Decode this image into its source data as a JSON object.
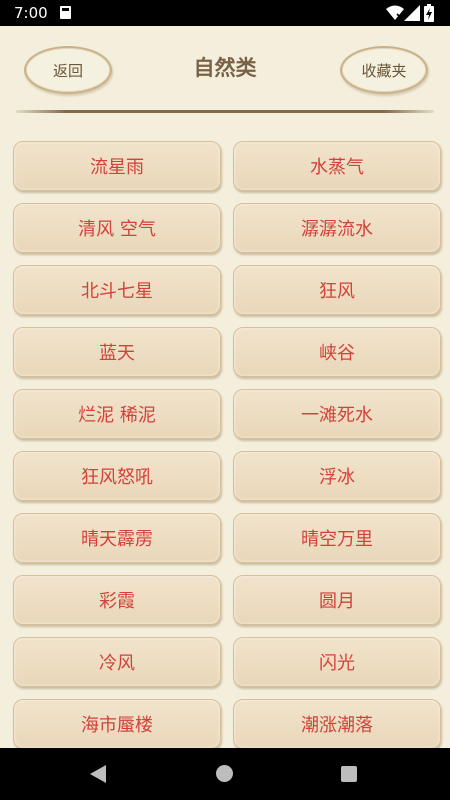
{
  "status": {
    "time": "7:00"
  },
  "header": {
    "back_label": "返回",
    "title": "自然类",
    "favorites_label": "收藏夹"
  },
  "items": [
    "流星雨",
    "水蒸气",
    "清风 空气",
    "潺潺流水",
    "北斗七星",
    "狂风",
    "蓝天",
    "峡谷",
    "烂泥 稀泥",
    "一滩死水",
    "狂风怒吼",
    "浮冰",
    "晴天霹雳",
    "晴空万里",
    "彩霞",
    "圆月",
    "冷风",
    "闪光",
    "海市蜃楼",
    "潮涨潮落"
  ],
  "colors": {
    "background": "#f4efdc",
    "item_text": "#d2423a",
    "title": "#7a6247"
  }
}
